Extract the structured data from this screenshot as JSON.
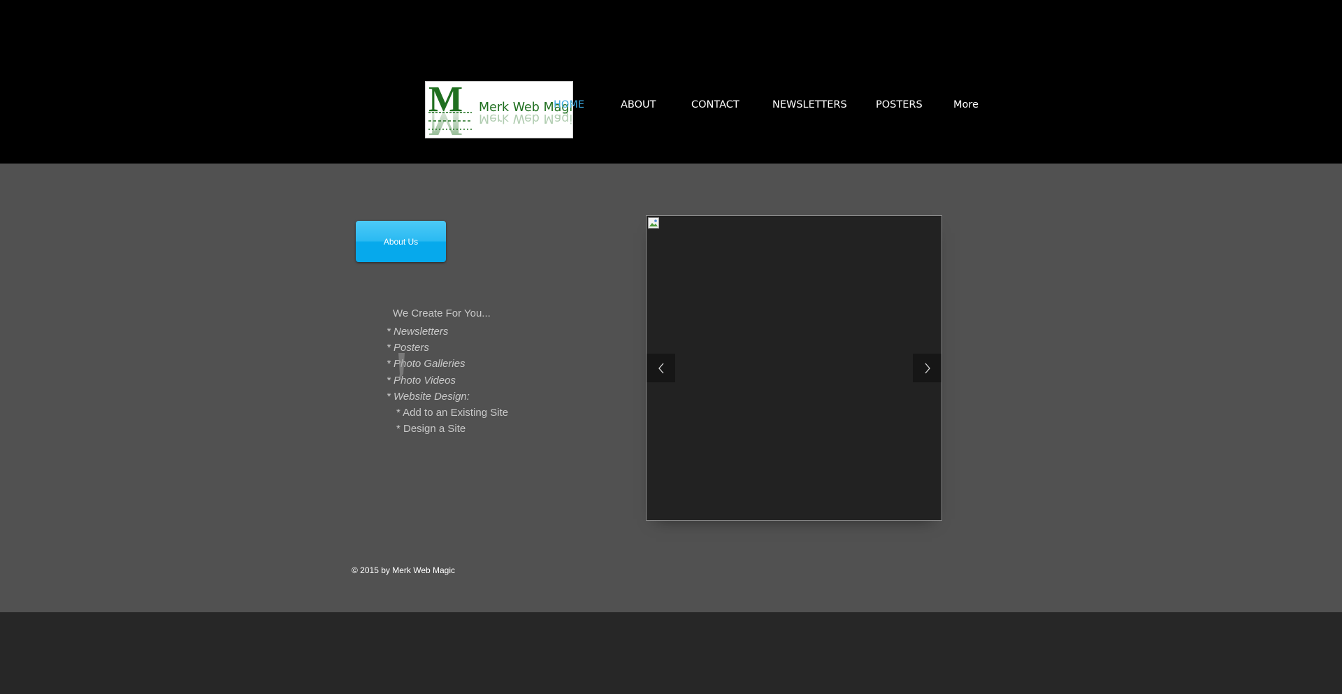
{
  "header": {
    "logo": {
      "text": "Merk Web Magic",
      "letter": "M"
    },
    "nav": [
      {
        "label": "HOME",
        "active": true
      },
      {
        "label": "ABOUT",
        "active": false
      },
      {
        "label": "CONTACT",
        "active": false
      },
      {
        "label": "NEWSLETTERS",
        "active": false
      },
      {
        "label": "POSTERS",
        "active": false
      },
      {
        "label": "More",
        "active": false
      }
    ]
  },
  "main": {
    "about_button_label": "About Us",
    "create_title": "We Create For You...",
    "create_items": [
      "* Newsletters",
      "* Posters",
      "* Photo Galleries",
      "* Photo Videos",
      "* Website Design:",
      "* Add to an Existing Site",
      "* Design a Site"
    ],
    "slideshow": {
      "prev_icon": "chevron-left-icon",
      "next_icon": "chevron-right-icon",
      "image_icon": "broken-image-icon"
    }
  },
  "footer": {
    "copyright": "© 2015 by Merk Web Magic"
  },
  "colors": {
    "header_bg": "#000000",
    "main_bg": "#515151",
    "footer_bg": "#272727",
    "nav_active": "#3ba9e0",
    "button_blue": "#06a9ec",
    "logo_green": "#1f6f1f"
  }
}
